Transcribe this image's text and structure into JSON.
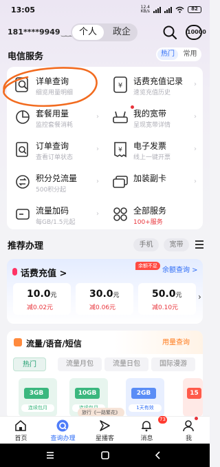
{
  "status_bar": {
    "time": "13:05",
    "net_speed_value": "12.4",
    "net_speed_unit": "KB/s",
    "network": "4G",
    "battery": "82"
  },
  "header": {
    "phone": "181****9949",
    "tabs": [
      "个人",
      "政企"
    ]
  },
  "services": {
    "title": "电信服务",
    "filters": [
      "热门",
      "常用"
    ],
    "items": [
      {
        "title": "详单查询",
        "subtitle": "细览用量明细",
        "icon": "detail-search-icon"
      },
      {
        "title": "话费充值记录",
        "subtitle": "速览充值历史",
        "icon": "recharge-record-icon"
      },
      {
        "title": "套餐用量",
        "subtitle": "监控套餐消耗",
        "icon": "package-usage-icon"
      },
      {
        "title": "我的宽带",
        "subtitle": "呈现宽带详情",
        "icon": "broadband-icon"
      },
      {
        "title": "订单查询",
        "subtitle": "查看订单状态",
        "icon": "order-search-icon"
      },
      {
        "title": "电子发票",
        "subtitle": "线上一键开票",
        "icon": "invoice-icon"
      },
      {
        "title": "积分兑流量",
        "subtitle": "500积分起",
        "icon": "points-exchange-icon"
      },
      {
        "title": "加装副卡",
        "subtitle": "",
        "icon": "add-card-icon"
      },
      {
        "title": "流量加码",
        "subtitle": "每GB/1.5元起",
        "icon": "data-boost-icon"
      },
      {
        "title": "全部服务",
        "subtitle": "100+服务",
        "icon": "all-services-icon"
      }
    ]
  },
  "recommend": {
    "title": "推荐办理",
    "chips": [
      "手机",
      "宽带"
    ],
    "recharge": {
      "title": "话费充值",
      "arrow": ">",
      "badge": "余额不足",
      "balance_link": "余额查询 >",
      "options": [
        {
          "amount": "10.0",
          "unit": "元",
          "discount": "减0.02元"
        },
        {
          "amount": "30.0",
          "unit": "元",
          "discount": "减0.06元"
        },
        {
          "amount": "50.0",
          "unit": "元",
          "discount": "减0.10元"
        }
      ]
    },
    "flow": {
      "title": "流量/语音/短信",
      "query_link": "用量查询",
      "tabs": [
        "热门",
        "流量月包",
        "流量日包",
        "国际漫游"
      ],
      "packages": [
        {
          "size": "3GB",
          "label": "连续包月"
        },
        {
          "size": "10GB",
          "label": "连续包月"
        },
        {
          "size": "2GB",
          "label": "1天有效"
        },
        {
          "size": "15",
          "label": ""
        }
      ],
      "tooltip": "旅行《一路繁花》"
    }
  },
  "bottom_nav": {
    "items": [
      {
        "label": "首页",
        "icon": "home-icon"
      },
      {
        "label": "查询办理",
        "icon": "query-icon"
      },
      {
        "label": "星播客",
        "icon": "podcast-icon"
      },
      {
        "label": "消息",
        "icon": "bell-icon"
      },
      {
        "label": "我",
        "icon": "profile-icon"
      }
    ],
    "message_badge": "73"
  },
  "colors": {
    "accent": "#2d6cf6",
    "red": "#e8333a",
    "orange": "#ff7a1a",
    "green": "#1f9d6e"
  }
}
